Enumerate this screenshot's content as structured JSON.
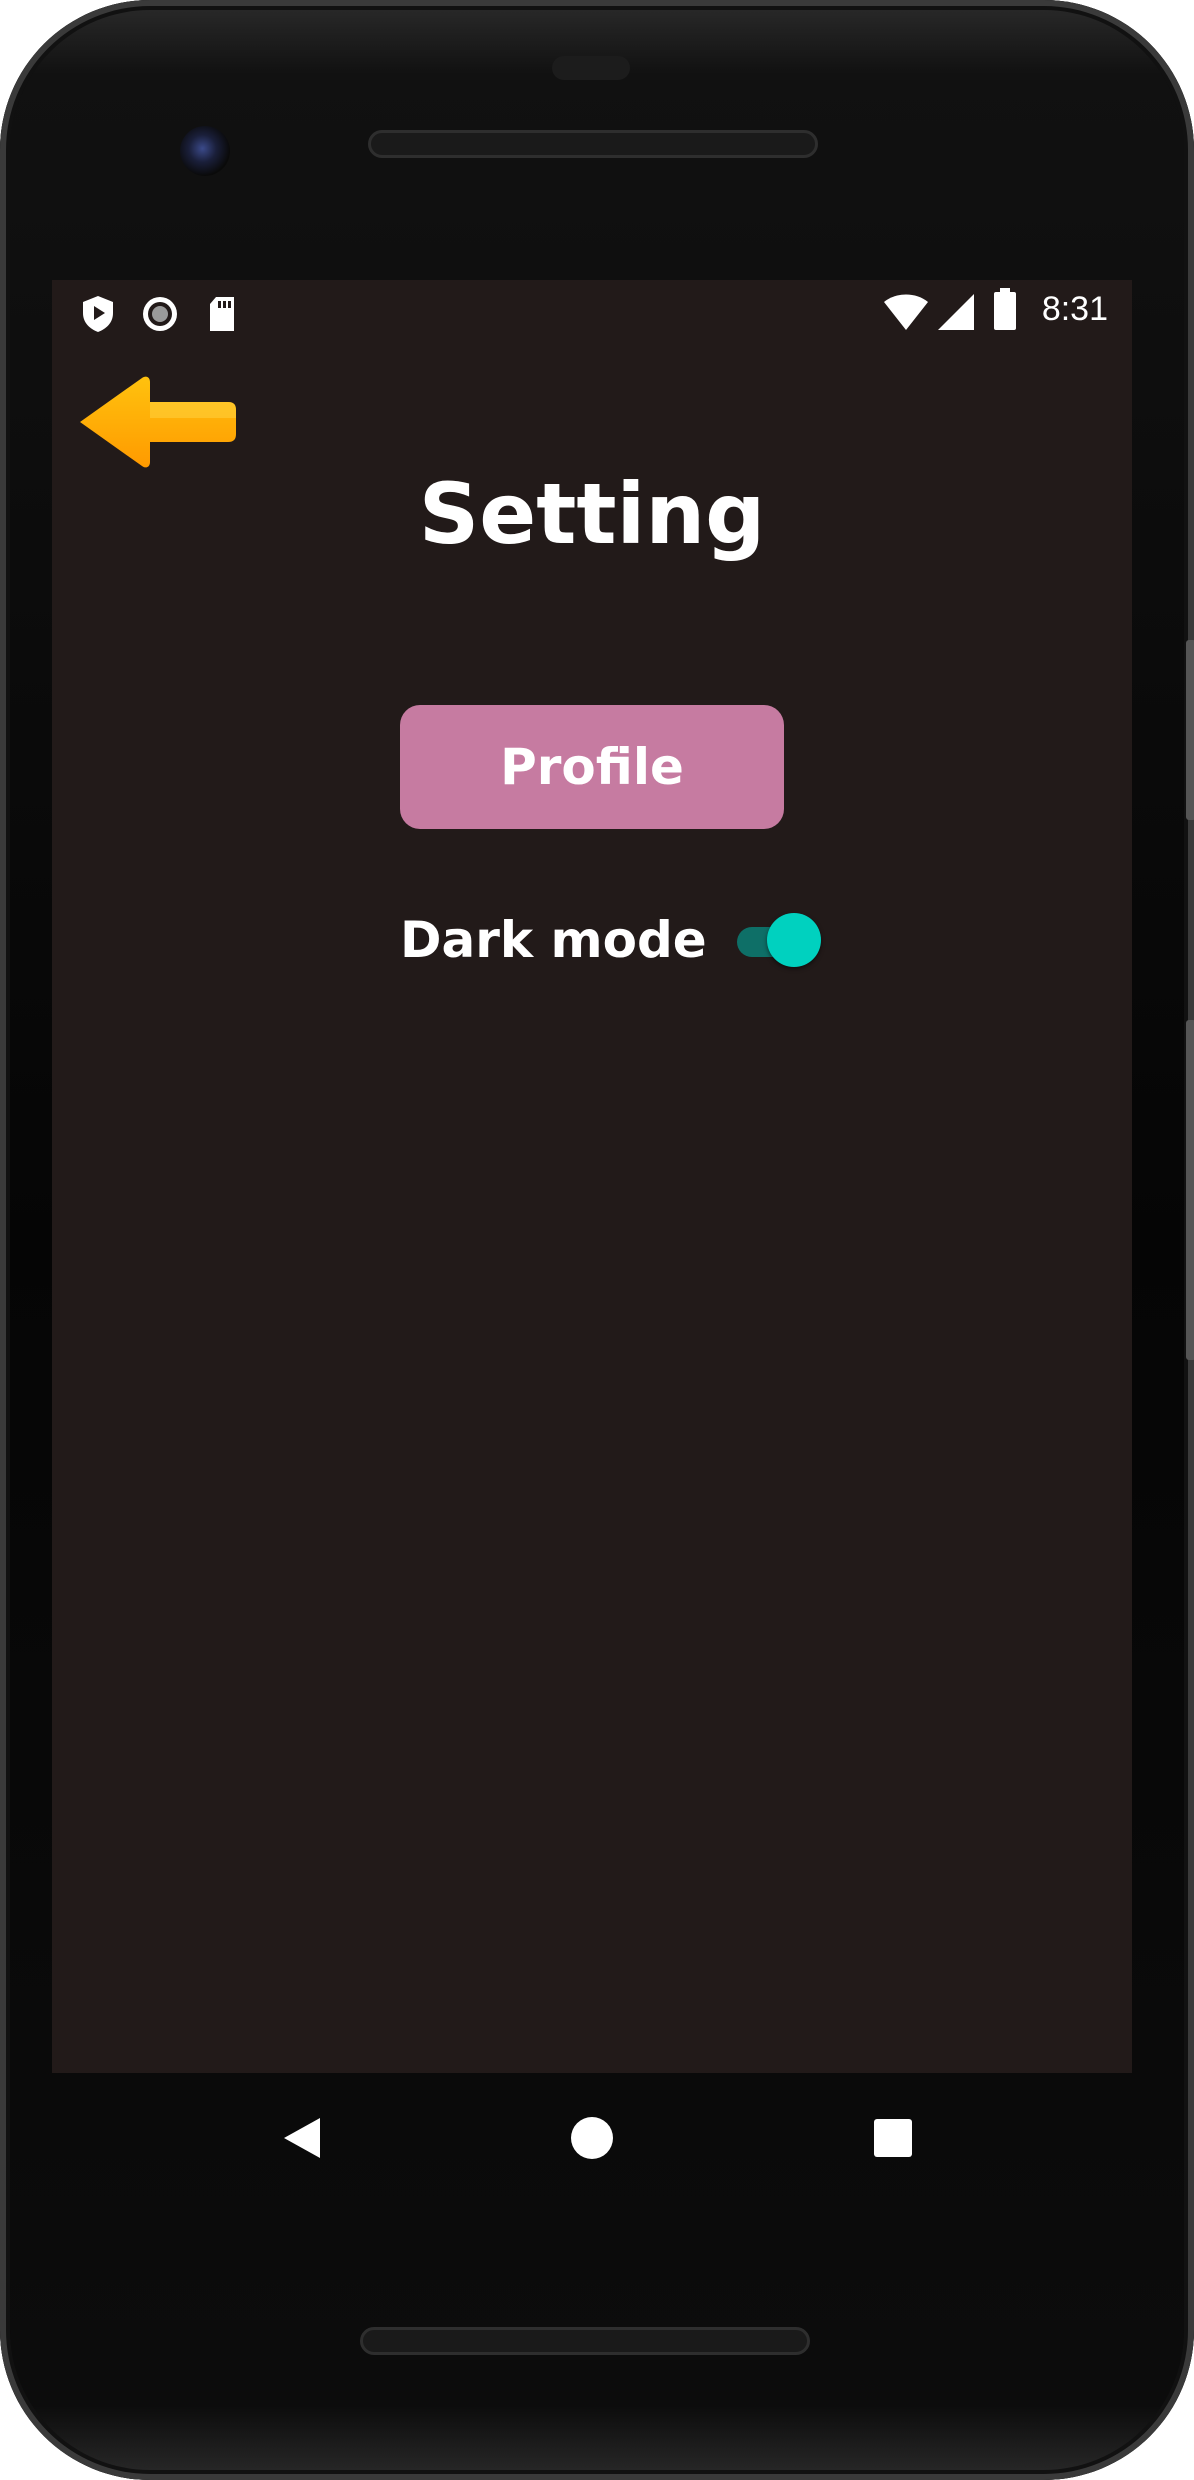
{
  "status_bar": {
    "time": "8:31",
    "left_icons": [
      "shield-play-icon",
      "circle-record-icon",
      "sd-card-icon"
    ],
    "right_icons": [
      "wifi-icon",
      "cell-signal-icon",
      "battery-icon"
    ]
  },
  "header": {
    "title": "Setting",
    "back_icon": "arrow-left-icon"
  },
  "profile_button": {
    "label": "Profile"
  },
  "dark_mode": {
    "label": "Dark mode",
    "enabled": true
  },
  "nav_bar": {
    "icons": [
      "back-triangle-icon",
      "home-circle-icon",
      "recents-square-icon"
    ]
  },
  "colors": {
    "screen_bg": "#221a19",
    "profile_button_bg": "#c67ba1",
    "toggle_thumb": "#00d1bf",
    "toggle_track": "#0e6f67",
    "back_arrow_top": "#ffc20e",
    "back_arrow_bottom": "#ff9a00"
  }
}
